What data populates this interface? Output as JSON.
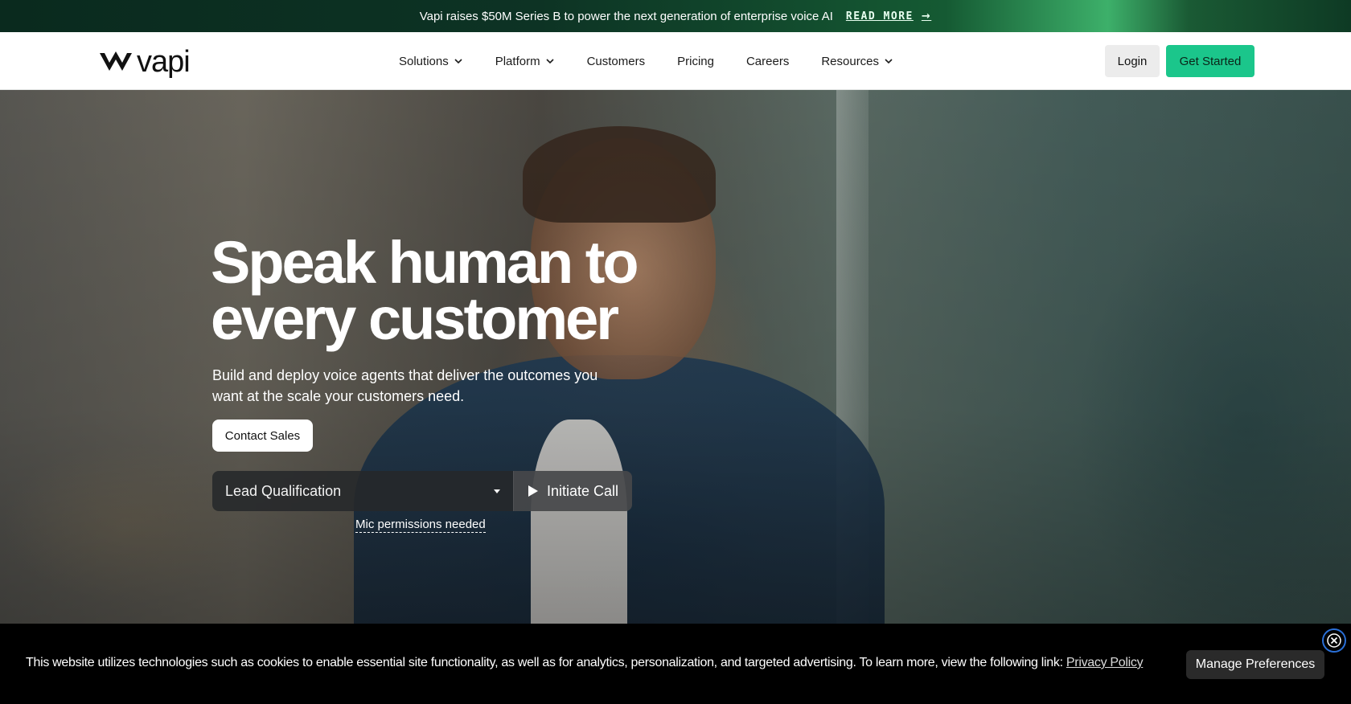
{
  "announcement": {
    "text": "Vapi raises $50M Series B to power the next generation of enterprise voice AI",
    "link_label": "READ MORE",
    "arrow": "→"
  },
  "nav": {
    "logo_text": "vapi",
    "items": [
      {
        "label": "Solutions",
        "has_dropdown": true
      },
      {
        "label": "Platform",
        "has_dropdown": true
      },
      {
        "label": "Customers",
        "has_dropdown": false
      },
      {
        "label": "Pricing",
        "has_dropdown": false
      },
      {
        "label": "Careers",
        "has_dropdown": false
      },
      {
        "label": "Resources",
        "has_dropdown": true
      }
    ],
    "login_label": "Login",
    "get_started_label": "Get Started"
  },
  "hero": {
    "title_line1": "Speak human to",
    "title_line2": "every customer",
    "subtitle": "Build and deploy voice agents that deliver the outcomes you want at the scale your customers need.",
    "contact_label": "Contact Sales",
    "call_select_value": "Lead Qualification",
    "call_button_label": "Initiate Call",
    "mic_note": "Mic permissions needed"
  },
  "cookie": {
    "text": "This website utilizes technologies such as cookies to enable essential site functionality, as well as for analytics, personalization, and targeted advertising. To learn more, view the following link:",
    "link_label": "Privacy Policy",
    "manage_label": "Manage Preferences"
  },
  "colors": {
    "accent": "#1bc68b",
    "cookie_bg": "#000000",
    "nav_bg": "#ffffff"
  },
  "icons": [
    "chevron-down-icon",
    "play-icon",
    "caret-down-icon",
    "close-icon",
    "vapi-logo-icon",
    "arrow-right-icon"
  ]
}
